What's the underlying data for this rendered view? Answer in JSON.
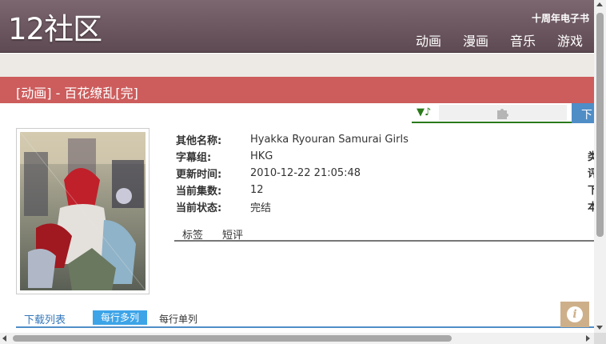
{
  "header": {
    "logo": "12社区",
    "tagline": "十周年电子书",
    "nav": [
      "动画",
      "漫画",
      "音乐",
      "游戏"
    ]
  },
  "title_bar": {
    "text": "[动画] - 百花缭乱[完]"
  },
  "player": {
    "note_symbol": "▼♪",
    "plugin_icon": "puzzle-icon"
  },
  "download_button": {
    "label": "下"
  },
  "info": {
    "rows": [
      {
        "key": "其他名称:",
        "value": "Hyakka Ryouran Samurai Girls"
      },
      {
        "key": "字幕组:",
        "value": "HKG"
      },
      {
        "key": "更新时间:",
        "value": "2010-12-22 21:05:48"
      },
      {
        "key": "当前集数:",
        "value": "12"
      },
      {
        "key": "当前状态:",
        "value": "完结"
      }
    ],
    "right_cut": [
      "类",
      "评",
      "下",
      "本"
    ]
  },
  "tabs": [
    "标签",
    "短评"
  ],
  "download_section": {
    "title": "下载列表",
    "btn_multi": "每行多列",
    "btn_single": "每行单列"
  },
  "info_badge": {
    "glyph": "i"
  },
  "colors": {
    "header": "#6b5660",
    "title_bar": "#cd5c5c",
    "accent_blue": "#4f8dc7",
    "player_green": "#2a7a1a"
  }
}
